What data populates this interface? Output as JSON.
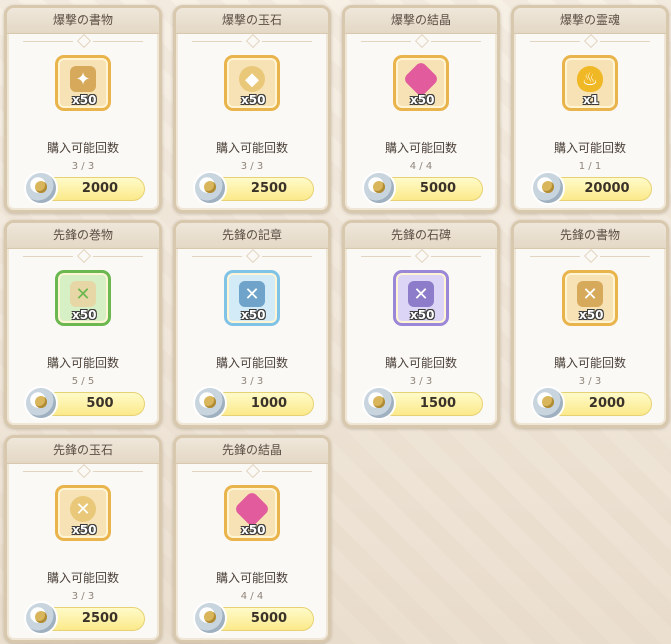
{
  "shop": {
    "limit_label": "購入可能回数",
    "items": [
      {
        "name": "爆撃の書物",
        "qty": "x50",
        "count": "3 / 3",
        "price": "2000",
        "glyph": "book-icon",
        "frame": "gold"
      },
      {
        "name": "爆撃の玉石",
        "qty": "x50",
        "count": "3 / 3",
        "price": "2500",
        "glyph": "jade-stone-icon",
        "frame": "gold"
      },
      {
        "name": "爆撃の結晶",
        "qty": "x50",
        "count": "4 / 4",
        "price": "5000",
        "glyph": "crystal-icon",
        "frame": "gold"
      },
      {
        "name": "爆撃の霊魂",
        "qty": "x1",
        "count": "1 / 1",
        "price": "20000",
        "glyph": "soul-flame-icon",
        "frame": "gold"
      },
      {
        "name": "先鋒の巻物",
        "qty": "x50",
        "count": "5 / 5",
        "price": "500",
        "glyph": "scroll-icon",
        "frame": "green"
      },
      {
        "name": "先鋒の記章",
        "qty": "x50",
        "count": "3 / 3",
        "price": "1000",
        "glyph": "emblem-icon",
        "frame": "blue"
      },
      {
        "name": "先鋒の石碑",
        "qty": "x50",
        "count": "3 / 3",
        "price": "1500",
        "glyph": "stele-icon",
        "frame": "purple"
      },
      {
        "name": "先鋒の書物",
        "qty": "x50",
        "count": "3 / 3",
        "price": "2000",
        "glyph": "book-icon",
        "frame": "gold"
      },
      {
        "name": "先鋒の玉石",
        "qty": "x50",
        "count": "3 / 3",
        "price": "2500",
        "glyph": "jade-stone-icon",
        "frame": "gold"
      },
      {
        "name": "先鋒の結晶",
        "qty": "x50",
        "count": "4 / 4",
        "price": "5000",
        "glyph": "crystal-icon",
        "frame": "gold"
      }
    ]
  },
  "colors": {
    "price_button": "#fbe98a",
    "card_border": "#d8c8ad",
    "frame_gold": "#e9b44c",
    "frame_green": "#6ab84f",
    "frame_blue": "#7fc3e6",
    "frame_purple": "#9b87d8"
  }
}
